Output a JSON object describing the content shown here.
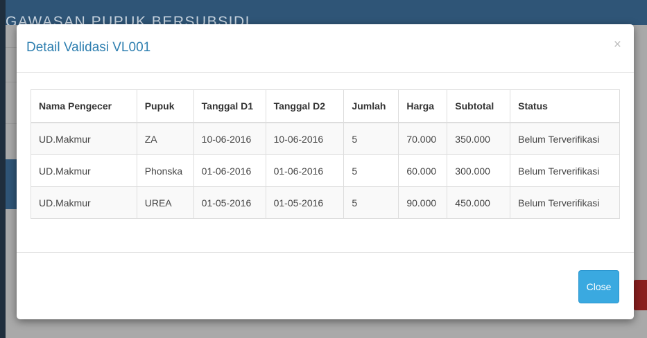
{
  "background": {
    "header_text": "GAWASAN PUPUK BERSUBSIDI"
  },
  "modal": {
    "title": "Detail Validasi VL001",
    "close_icon": "×",
    "table": {
      "headers": [
        "Nama Pengecer",
        "Pupuk",
        "Tanggal D1",
        "Tanggal D2",
        "Jumlah",
        "Harga",
        "Subtotal",
        "Status"
      ],
      "rows": [
        [
          "UD.Makmur",
          "ZA",
          "10-06-2016",
          "10-06-2016",
          "5",
          "70.000",
          "350.000",
          "Belum Terverifikasi"
        ],
        [
          "UD.Makmur",
          "Phonska",
          "01-06-2016",
          "01-06-2016",
          "5",
          "60.000",
          "300.000",
          "Belum Terverifikasi"
        ],
        [
          "UD.Makmur",
          "UREA",
          "01-05-2016",
          "01-05-2016",
          "5",
          "90.000",
          "450.000",
          "Belum Terverifikasi"
        ]
      ]
    },
    "footer": {
      "close_label": "Close"
    }
  },
  "colors": {
    "title": "#2e7fb0",
    "close_button": "#3aa9e0",
    "header_bar": "#2f5577"
  }
}
